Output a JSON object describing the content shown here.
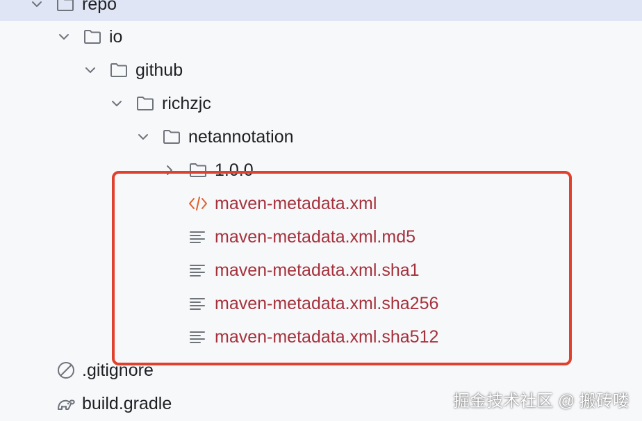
{
  "colors": {
    "selected_row_bg": "#dfe5f4",
    "vcs_modified_text": "#a5313c",
    "highlight_border": "#e0412c",
    "xml_icon": "#e0602a"
  },
  "tree": {
    "items": [
      {
        "label": "repo",
        "icon": "folder-icon",
        "expanded": true
      },
      {
        "label": "io",
        "icon": "folder-icon",
        "expanded": true
      },
      {
        "label": "github",
        "icon": "folder-icon",
        "expanded": true
      },
      {
        "label": "richzjc",
        "icon": "folder-icon",
        "expanded": true
      },
      {
        "label": "netannotation",
        "icon": "folder-icon",
        "expanded": true
      },
      {
        "label": "1.0.0",
        "icon": "folder-icon",
        "expanded": false
      },
      {
        "label": "maven-metadata.xml",
        "icon": "xml-file-icon"
      },
      {
        "label": "maven-metadata.xml.md5",
        "icon": "text-file-icon"
      },
      {
        "label": "maven-metadata.xml.sha1",
        "icon": "text-file-icon"
      },
      {
        "label": "maven-metadata.xml.sha256",
        "icon": "text-file-icon"
      },
      {
        "label": "maven-metadata.xml.sha512",
        "icon": "text-file-icon"
      },
      {
        "label": ".gitignore",
        "icon": "ignore-file-icon"
      },
      {
        "label": "build.gradle",
        "icon": "gradle-elephant-icon"
      }
    ]
  },
  "watermark": "掘金技术社区 @ 搬砖喽"
}
